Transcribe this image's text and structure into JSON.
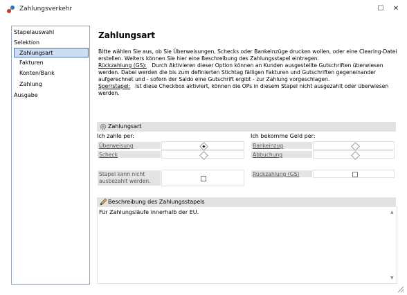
{
  "window": {
    "title": "Zahlungsverkehr",
    "maximize_glyph": "☐",
    "close_glyph": "✕"
  },
  "sidebar": {
    "items": [
      {
        "label": "Stapelauswahl"
      },
      {
        "label": "Selektion"
      },
      {
        "label": "Zahlungsart"
      },
      {
        "label": "Fakturen"
      },
      {
        "label": "Konten/Bank"
      },
      {
        "label": "Zahlung"
      },
      {
        "label": "Ausgabe"
      }
    ]
  },
  "main": {
    "heading": "Zahlungsart",
    "intro": "Bitte wählen Sie aus, ob Sie Überweisungen, Schecks oder Bankeinzüge drucken wollen, oder eine Clearing-Datei erstellen. Weiters können Sie hier eine Beschreibung des Zahlungsstapel eintragen.",
    "refund_term": "Rückzahlung (GS):",
    "refund_text": "Durch Aktivieren dieser Option können an Kunden ausgestellte Gutschriften überwiesen werden. Dabei werden die bis zum definierten Stichtag fälligen Fakturen und Gutschriften gegeneinander aufgerechnet und - sofern der Saldo eine Gutschrift ergibt - zur Zahlung vorgeschlagen.",
    "lock_term": "Sperrstapel:",
    "lock_text": "Ist diese Checkbox aktiviert, können die OPs in diesem Stapel nicht ausgezahlt oder überwiesen werden."
  },
  "payment_section": {
    "title": "Zahlungsart",
    "i_pay_label": "Ich zahle per:",
    "i_receive_label": "Ich bekomme Geld per:",
    "options_pay": [
      {
        "label": "Überweisung",
        "selected": true
      },
      {
        "label": "Scheck",
        "selected": false
      }
    ],
    "options_receive": [
      {
        "label": "Bankeinzug",
        "selected": false
      },
      {
        "label": "Abbuchung",
        "selected": false
      }
    ],
    "not_payable_label": "Stapel kann nicht ausbezahlt werden.",
    "not_payable_checked": false,
    "refund_label": "Rückzahlung (GS)",
    "refund_checked": false
  },
  "description_section": {
    "title": "Beschreibung des Zahlungsstapels",
    "value": "Für Zahlungsläufe innerhalb der EU.",
    "scroll_up": "▲",
    "scroll_down": "▼"
  }
}
